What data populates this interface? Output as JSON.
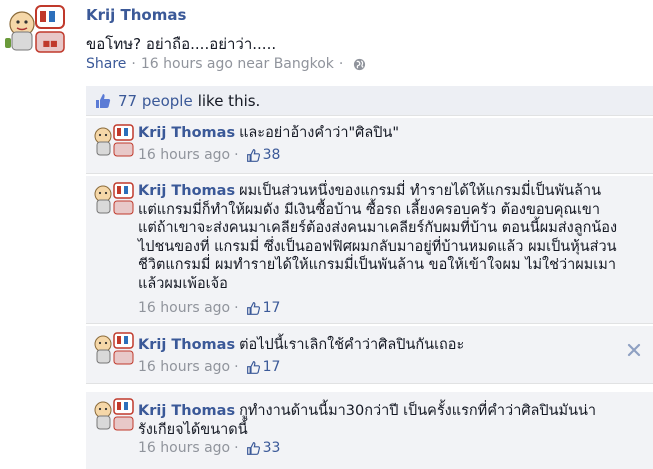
{
  "post": {
    "author": "Krij Thomas",
    "text": "ขอโทษ? อย่าถือ....อย่าว่า.....",
    "share_label": "Share",
    "time": "16 hours ago near Bangkok",
    "likes_count_label": "77 people",
    "likes_suffix": "like this."
  },
  "comments": [
    {
      "author": "Krij Thomas",
      "text": "และอย่าอ้างคำว่า\"ศิลปิน\"",
      "time": "16 hours ago",
      "likes": "38"
    },
    {
      "author": "Krij Thomas",
      "text": "ผมเป็นส่วนหนึ่งของแกรมมี่ ทำรายได้ให้แกรมมี่เป็นพันล้าน แต่แกรมมี่ก็ทำให้ผมดัง มีเงินซื้อบ้าน ซื้อรถ เลี้ยงครอบครัว ต้องขอบคุณเขา แต่ถ้าเขาจะส่งคนมาเคลียร์ต้องส่งคนมาเคลียร์กับผมที่บ้าน ตอนนี้ผมส่งลูกน้องไปชนของที่ แกรมมี่ ซึ่งเป็นออฟฟิศผมกลับมาอยู่ที่บ้านหมดแล้ว ผมเป็นหุ้นส่วนชีวิตแกรมมี่ ผมทำรายได้ให้แกรมมี่เป็นพันล้าน ขอให้เข้าใจผม ไม่ใช่ว่าผมเมาแล้วผมเพ้อเจ้อ",
      "time": "16 hours ago",
      "likes": "17"
    },
    {
      "author": "Krij Thomas",
      "text": "ต่อไปนี้เราเลิกใช้คำว่าศิลปินกันเถอะ",
      "time": "16 hours ago",
      "likes": "17"
    },
    {
      "author": "Krij Thomas",
      "text": "กูทำงานด้านนี้มา30กว่าปี เป็นครั้งแรกที่คำว่าศิลปินมันน่ารังเกียจได้ขนาดนี้",
      "time": "16 hours ago",
      "likes": "33"
    }
  ],
  "colors": {
    "link": "#3b5998",
    "meta": "#90949c",
    "comment_bg": "#f2f3f6"
  },
  "icons": [
    "avatar-icon",
    "globe-icon",
    "thumbs-up-icon",
    "close-icon"
  ]
}
